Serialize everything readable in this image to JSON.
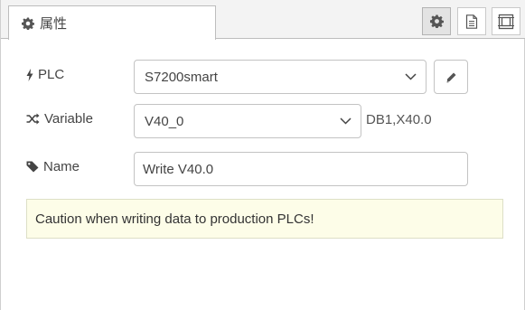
{
  "header": {
    "tab_label": "属性",
    "tab_icon": "gear-icon",
    "buttons": [
      {
        "name": "settings",
        "icon": "gear-icon",
        "active": true
      },
      {
        "name": "description",
        "icon": "document-icon",
        "active": false
      },
      {
        "name": "appearance",
        "icon": "frame-icon",
        "active": false
      }
    ]
  },
  "form": {
    "plc": {
      "label": "PLC",
      "icon": "bolt-icon",
      "value": "S7200smart",
      "edit_icon": "pencil-icon"
    },
    "variable": {
      "label": "Variable",
      "icon": "shuffle-icon",
      "value": "V40_0",
      "address": "DB1,X40.0"
    },
    "name": {
      "label": "Name",
      "icon": "tag-icon",
      "value": "Write V40.0"
    }
  },
  "note": {
    "text": "Caution when writing data to production PLCs!"
  },
  "colors": {
    "note_bg": "#fdfde8",
    "border": "#c3c3c3",
    "header_bg": "#f3f3f3"
  }
}
